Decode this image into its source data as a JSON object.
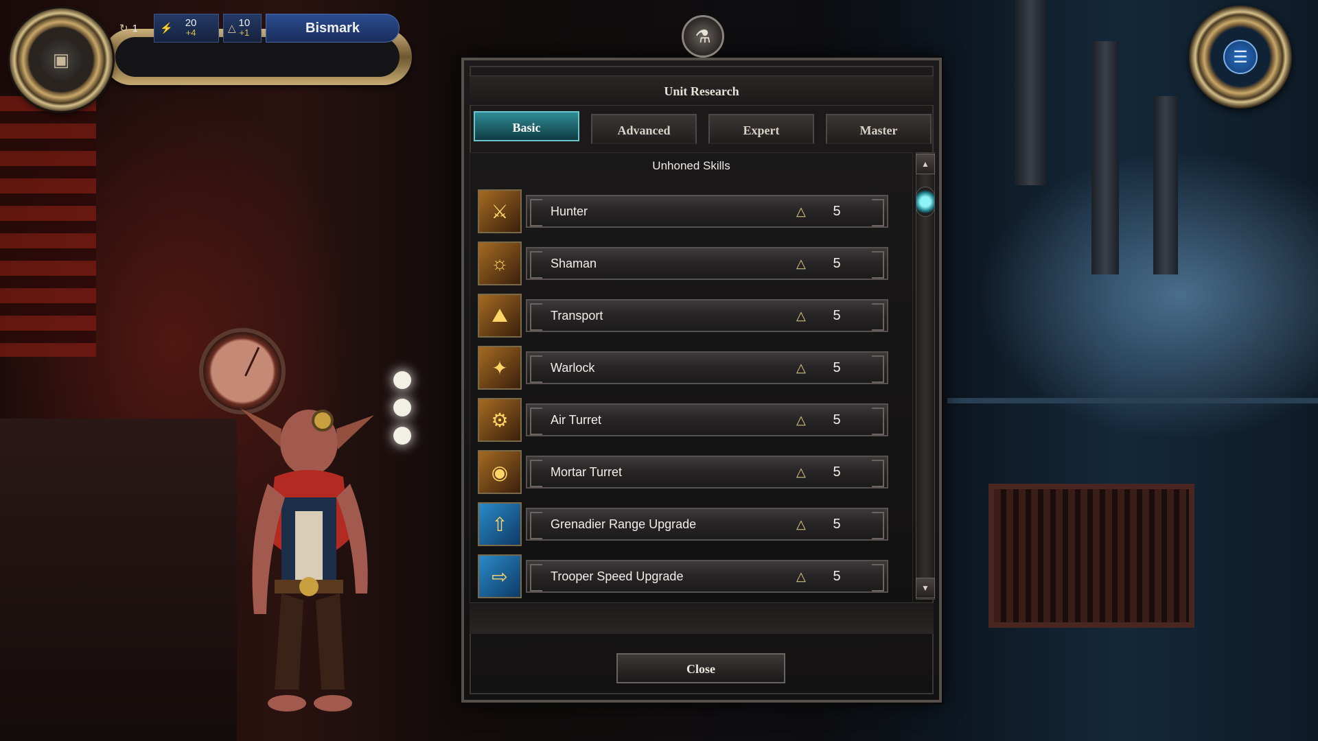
{
  "hud": {
    "turn_icon": "turn-cycle-icon",
    "turn": "1",
    "resource_icon": "resource-icon",
    "resource_value": "20",
    "resource_gain": "+4",
    "science_icon": "flask-icon",
    "science_value": "10",
    "science_gain": "+1",
    "player_name": "Bismark"
  },
  "dialog": {
    "title": "Unit Research",
    "tabs": [
      {
        "label": "Basic",
        "active": true
      },
      {
        "label": "Advanced",
        "active": false
      },
      {
        "label": "Expert",
        "active": false
      },
      {
        "label": "Master",
        "active": false
      }
    ],
    "section_title": "Unhoned Skills",
    "items": [
      {
        "name": "Hunter",
        "cost": "5",
        "icon": "hunter-icon"
      },
      {
        "name": "Shaman",
        "cost": "5",
        "icon": "shaman-icon"
      },
      {
        "name": "Transport",
        "cost": "5",
        "icon": "transport-icon"
      },
      {
        "name": "Warlock",
        "cost": "5",
        "icon": "warlock-icon"
      },
      {
        "name": "Air Turret",
        "cost": "5",
        "icon": "air-turret-icon"
      },
      {
        "name": "Mortar Turret",
        "cost": "5",
        "icon": "mortar-turret-icon"
      },
      {
        "name": "Grenadier Range Upgrade",
        "cost": "5",
        "icon": "range-upgrade-icon"
      },
      {
        "name": "Trooper Speed Upgrade",
        "cost": "5",
        "icon": "speed-upgrade-icon"
      }
    ],
    "close_label": "Close"
  },
  "colors": {
    "active_tab": "#2f8c94",
    "player_banner": "#2b4c8f",
    "gain_text": "#e0c24a"
  }
}
